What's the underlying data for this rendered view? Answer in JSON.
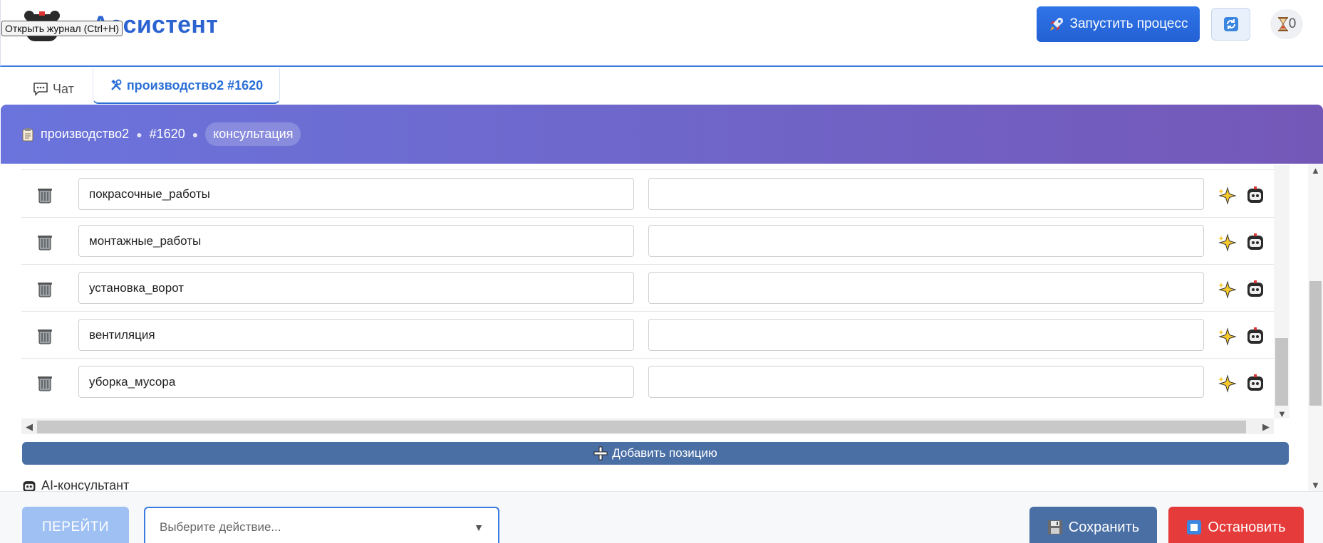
{
  "header": {
    "title": "Ассистент",
    "tooltip": "Открыть журнал (Ctrl+H)",
    "launch_label": "Запустить процесс",
    "counter": "0",
    "launch_icon": "rocket-icon",
    "refresh_icon": "refresh-icon",
    "hourglass_icon": "hourglass-icon"
  },
  "tabs": [
    {
      "label": "Чат",
      "icon": "chat-icon",
      "active": false
    },
    {
      "label": "производство2 #1620",
      "icon": "tools-icon",
      "active": true
    }
  ],
  "banner": {
    "process": "производство2",
    "number": "#1620",
    "mode": "консультация",
    "icon": "clipboard-icon"
  },
  "rows": [
    {
      "name": "покрасочные_работы",
      "value": ""
    },
    {
      "name": "монтажные_работы",
      "value": ""
    },
    {
      "name": "установка_ворот",
      "value": ""
    },
    {
      "name": "вентиляция",
      "value": ""
    },
    {
      "name": "уборка_мусора",
      "value": ""
    }
  ],
  "actions": {
    "add_label": "Добавить позицию",
    "ai_label": "AI-консультант",
    "go_label": "ПЕРЕЙТИ",
    "select_placeholder": "Выберите действие...",
    "save_label": "Сохранить",
    "stop_label": "Остановить"
  },
  "colors": {
    "accent": "#2b63d1",
    "banner_start": "#6a74dc",
    "banner_end": "#7458b8",
    "save": "#4a6fa5",
    "stop": "#e63b3b",
    "go_disabled": "#9fc0f2"
  }
}
